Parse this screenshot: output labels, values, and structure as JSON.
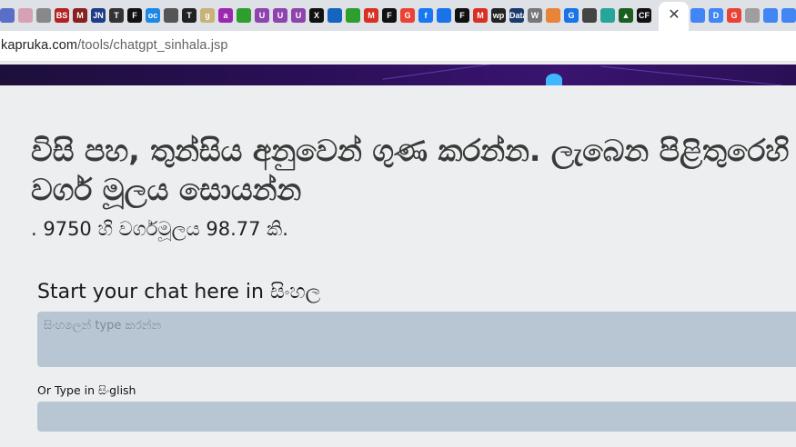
{
  "browser": {
    "tabs": [
      {
        "icon": "document-icon",
        "text": "",
        "color": "#5a6ec8"
      },
      {
        "icon": "loading-icon",
        "text": "",
        "color": "#d6a2b3"
      },
      {
        "icon": "swap-icon",
        "text": "",
        "color": "#888888"
      },
      {
        "icon": "bs-icon",
        "text": "BS",
        "color": "#b22222"
      },
      {
        "icon": "m-logo-icon",
        "text": "M",
        "color": "#8a1f1f"
      },
      {
        "icon": "jn-icon",
        "text": "JN",
        "color": "#1f3c88"
      },
      {
        "icon": "tl-icon",
        "text": "T",
        "color": "#333333"
      },
      {
        "icon": "f-icon",
        "text": "F",
        "color": "#111111"
      },
      {
        "icon": "oc-icon",
        "text": "oc",
        "color": "#1e88e5"
      },
      {
        "icon": "globe-icon",
        "text": "",
        "color": "#555555"
      },
      {
        "icon": "nyt-icon",
        "text": "T",
        "color": "#222222"
      },
      {
        "icon": "g-icon",
        "text": "g",
        "color": "#c9b27a"
      },
      {
        "icon": "a-icon",
        "text": "a",
        "color": "#9c27b0"
      },
      {
        "icon": "squares-icon",
        "text": "",
        "color": "#2e9e2e"
      },
      {
        "icon": "u-icon",
        "text": "U",
        "color": "#8e44ad"
      },
      {
        "icon": "u-icon",
        "text": "U",
        "color": "#8e44ad"
      },
      {
        "icon": "u-icon",
        "text": "U",
        "color": "#8e44ad"
      },
      {
        "icon": "x-icon",
        "text": "X",
        "color": "#111111"
      },
      {
        "icon": "grid-icon",
        "text": "",
        "color": "#1565c0"
      },
      {
        "icon": "squares-icon",
        "text": "",
        "color": "#2e9e2e"
      },
      {
        "icon": "gmail-icon",
        "text": "M",
        "color": "#d93025"
      },
      {
        "icon": "f-icon",
        "text": "F",
        "color": "#111111"
      },
      {
        "icon": "google-icon",
        "text": "G",
        "color": "#ea4335"
      },
      {
        "icon": "facebook-icon",
        "text": "f",
        "color": "#1877f2"
      },
      {
        "icon": "puzzle-icon",
        "text": "",
        "color": "#1a73e8"
      },
      {
        "icon": "f-icon",
        "text": "F",
        "color": "#111111"
      },
      {
        "icon": "gmail-icon",
        "text": "M",
        "color": "#d93025"
      },
      {
        "icon": "wp-icon",
        "text": "wp",
        "color": "#222222"
      },
      {
        "icon": "data-icon",
        "text": "Data",
        "color": "#1a3a6b"
      },
      {
        "icon": "w-icon",
        "text": "W",
        "color": "#777777"
      },
      {
        "icon": "circle-icon",
        "text": "",
        "color": "#e8833a"
      },
      {
        "icon": "g-icon",
        "text": "G",
        "color": "#1a73e8"
      },
      {
        "icon": "ring-icon",
        "text": "",
        "color": "#444444"
      },
      {
        "icon": "teal-icon",
        "text": "",
        "color": "#26a69a"
      },
      {
        "icon": "triangle-icon",
        "text": "▲",
        "color": "#1b5e20"
      },
      {
        "icon": "cf-icon",
        "text": "CF",
        "color": "#111111"
      }
    ],
    "close_symbol": "✕",
    "right_tabs": [
      {
        "icon": "docs-icon",
        "text": "",
        "color": "#4285f4"
      },
      {
        "icon": "d-icon",
        "text": "D",
        "color": "#4285f4"
      },
      {
        "icon": "google-icon",
        "text": "G",
        "color": "#ea4335"
      },
      {
        "icon": "page-icon",
        "text": "",
        "color": "#9e9e9e"
      },
      {
        "icon": "docs-icon",
        "text": "",
        "color": "#4285f4"
      },
      {
        "icon": "docs-icon",
        "text": "",
        "color": "#4285f4"
      }
    ],
    "url_host": "kapruka.com",
    "url_path": "/tools/chatgpt_sinhala.jsp"
  },
  "page": {
    "question": "විසි පහ, තුන්සිය අනුවෙන් ගුණ කරන්න. ලැබෙන පිළිතුරෙහි වර්ග මූලය සොයන්න",
    "answer": ". 9750 හි වර්ගමූලය 98.77 කි.",
    "chat_title": "Start your chat here in සිංහල",
    "chat_placeholder": "සිංහලෙන් type කරන්න",
    "singlish_label": "Or Type in සිංglish",
    "singlish_value": ""
  }
}
